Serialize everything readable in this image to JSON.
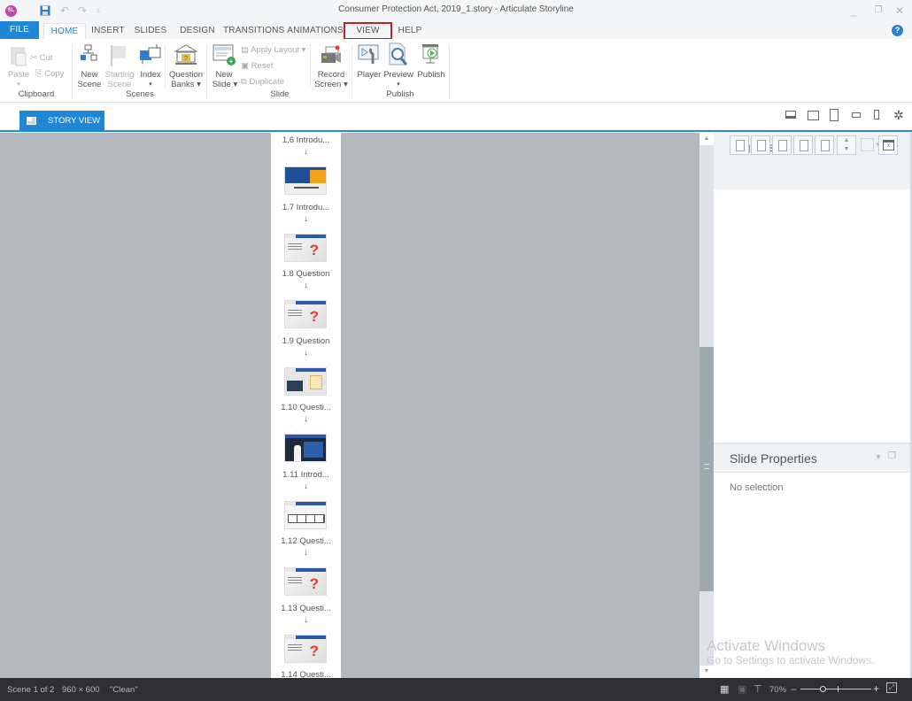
{
  "window": {
    "title": "Consumer Protection Act, 2019_1.story -  Articulate Storyline",
    "app_badge": "SL",
    "qat": [
      "save-icon",
      "undo-icon",
      "redo-icon",
      "customize-icon"
    ],
    "controls": {
      "minimize": "_",
      "restore": "❐",
      "close": "✕"
    }
  },
  "tabs": [
    {
      "label": "FILE"
    },
    {
      "label": "HOME",
      "active": true
    },
    {
      "label": "INSERT"
    },
    {
      "label": "SLIDES"
    },
    {
      "label": "DESIGN"
    },
    {
      "label": "TRANSITIONS"
    },
    {
      "label": "ANIMATIONS"
    },
    {
      "label": "VIEW",
      "highlighted": true
    },
    {
      "label": "HELP"
    }
  ],
  "help_icon": "?",
  "ribbon": {
    "clipboard": {
      "label": "Clipboard",
      "paste": "Paste",
      "cut": "Cut",
      "copy": "Copy"
    },
    "scenes": {
      "label": "Scenes",
      "new_scene": [
        "New",
        "Scene"
      ],
      "starting_scene": [
        "Starting",
        "Scene"
      ],
      "index": "Index",
      "question_banks": [
        "Question",
        "Banks ▾"
      ]
    },
    "slide": {
      "label": "Slide",
      "new_slide": [
        "New",
        "Slide ▾"
      ],
      "apply_layout": "Apply Layout ▾",
      "reset": "Reset",
      "duplicate": "Duplicate",
      "record_screen": [
        "Record",
        "Screen ▾"
      ]
    },
    "publish": {
      "label": "Publish",
      "player": "Player",
      "preview": "Preview",
      "publish": "Publish"
    }
  },
  "view": {
    "story_view_tab": "STORY VIEW",
    "device_icons": [
      "desktop-icon",
      "tablet-landscape-icon",
      "tablet-portrait-icon",
      "phone-landscape-icon",
      "phone-portrait-icon",
      "settings-icon"
    ]
  },
  "slides": [
    {
      "label": "1.6 Introdu...",
      "thumb": "orange"
    },
    {
      "label": "1.7 Introdu...",
      "thumb": "question"
    },
    {
      "label": "1.8 Question",
      "thumb": "question"
    },
    {
      "label": "1.9 Question",
      "thumb": "form"
    },
    {
      "label": "1.10 Questi...",
      "thumb": "presenter"
    },
    {
      "label": "1.11 Introd...",
      "thumb": "table"
    },
    {
      "label": "1.12 Questi...",
      "thumb": "question"
    },
    {
      "label": "1.13 Questi...",
      "thumb": "question"
    },
    {
      "label": "1.14 Questi...",
      "thumb": null
    }
  ],
  "panels": {
    "triggers": {
      "title": "Triggers",
      "buttons": [
        "new-trigger",
        "edit-trigger",
        "copy-trigger",
        "paste-trigger",
        "delete-trigger",
        "move-trigger",
        "blank",
        "variables"
      ]
    },
    "slide_properties": {
      "title": "Slide Properties",
      "empty_text": "No selection"
    }
  },
  "watermark": {
    "line1": "Activate Windows",
    "line2": "Go to Settings to activate Windows."
  },
  "status": {
    "scene": "Scene 1 of 2",
    "size": "960 × 600",
    "theme": "\"Clean\"",
    "zoom": "70%",
    "zoom_minus": "−",
    "zoom_plus": "+"
  }
}
